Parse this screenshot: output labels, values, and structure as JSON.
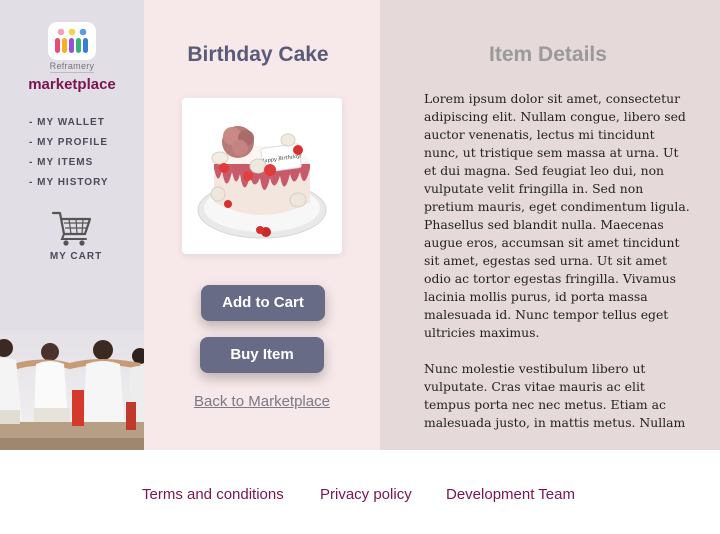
{
  "sidebar": {
    "brand_sub": "Reframery",
    "brand_name": "marketplace",
    "nav": [
      {
        "label": "- MY WALLET"
      },
      {
        "label": "- MY PROFILE"
      },
      {
        "label": "- MY ITEMS"
      },
      {
        "label": "- MY HISTORY"
      }
    ],
    "cart_label": "MY CART",
    "cart_icon": "shopping-cart-icon"
  },
  "product": {
    "title": "Birthday Cake",
    "image_icon": "birthday-cake-image",
    "cake_topper_text": "Happy Birthday!",
    "add_to_cart_label": "Add to Cart",
    "buy_label": "Buy Item",
    "back_link": "Back to Marketplace"
  },
  "details": {
    "title": "Item Details",
    "paragraph1": "Lorem ipsum dolor sit amet, consectetur adipiscing elit. Nullam congue, libero sed auctor venenatis, lectus mi tincidunt nunc, ut tristique sem massa at urna. Ut et dui magna. Sed feugiat leo dui, non vulputate velit fringilla in. Sed non pretium mauris, eget condimentum ligula. Phasellus sed blandit nulla. Maecenas augue eros, accumsan sit amet tincidunt sit amet, egestas sed urna. Ut sit amet odio ac tortor egestas fringilla. Vivamus lacinia mollis purus, id porta massa malesuada id. Nunc tempor tellus eget ultricies maximus.",
    "paragraph2": "Nunc molestie vestibulum libero ut vulputate. Cras vitae mauris ac elit tempus porta nec nec metus. Etiam ac malesuada justo, in mattis metus. Nullam"
  },
  "footer": {
    "terms": "Terms and conditions",
    "privacy": "Privacy policy",
    "dev_team": "Development Team"
  },
  "colors": {
    "brand": "#7b1450",
    "button": "#676b86",
    "sidebar_bg": "#e2dee5",
    "middle_bg": "#f7e8e9",
    "details_bg": "#e6d9da"
  }
}
